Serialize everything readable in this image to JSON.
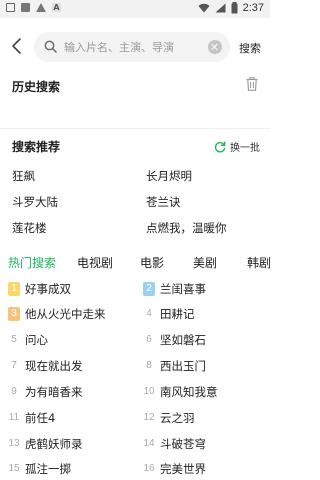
{
  "status_bar": {
    "time": "2:37",
    "notification_icons": [
      "image-icon",
      "block-icon",
      "alert-triangle-icon",
      "a-icon"
    ]
  },
  "header": {
    "search_placeholder": "输入片名、主演、导演",
    "search_button": "搜索"
  },
  "history": {
    "title": "历史搜索"
  },
  "recommendations": {
    "title": "搜索推荐",
    "refresh_label": "换一批",
    "items": [
      "狂飙",
      "长月烬明",
      "斗罗大陆",
      "苍兰诀",
      "莲花楼",
      "点燃我，温暖你"
    ]
  },
  "tabs": [
    {
      "label": "热门搜索",
      "active": true
    },
    {
      "label": "电视剧",
      "active": false
    },
    {
      "label": "电影",
      "active": false
    },
    {
      "label": "美剧",
      "active": false
    },
    {
      "label": "韩剧",
      "active": false
    }
  ],
  "hot_list": [
    {
      "rank": "1",
      "title": "好事成双"
    },
    {
      "rank": "2",
      "title": "兰闺喜事"
    },
    {
      "rank": "3",
      "title": "他从火光中走来"
    },
    {
      "rank": "4",
      "title": "田耕记"
    },
    {
      "rank": "5",
      "title": "问心"
    },
    {
      "rank": "6",
      "title": "坚如磐石"
    },
    {
      "rank": "7",
      "title": "现在就出发"
    },
    {
      "rank": "8",
      "title": "西出玉门"
    },
    {
      "rank": "9",
      "title": "为有暗香来"
    },
    {
      "rank": "10",
      "title": "南风知我意"
    },
    {
      "rank": "11",
      "title": "前任4"
    },
    {
      "rank": "12",
      "title": "云之羽"
    },
    {
      "rank": "13",
      "title": "虎鹤妖师录"
    },
    {
      "rank": "14",
      "title": "斗破苍穹"
    },
    {
      "rank": "15",
      "title": "孤注一掷"
    },
    {
      "rank": "16",
      "title": "完美世界"
    }
  ],
  "colors": {
    "accent_green": "#1fb55a",
    "rank1": "#fbd66a",
    "rank2": "#9bd0f5",
    "rank3": "#f8c17c"
  }
}
